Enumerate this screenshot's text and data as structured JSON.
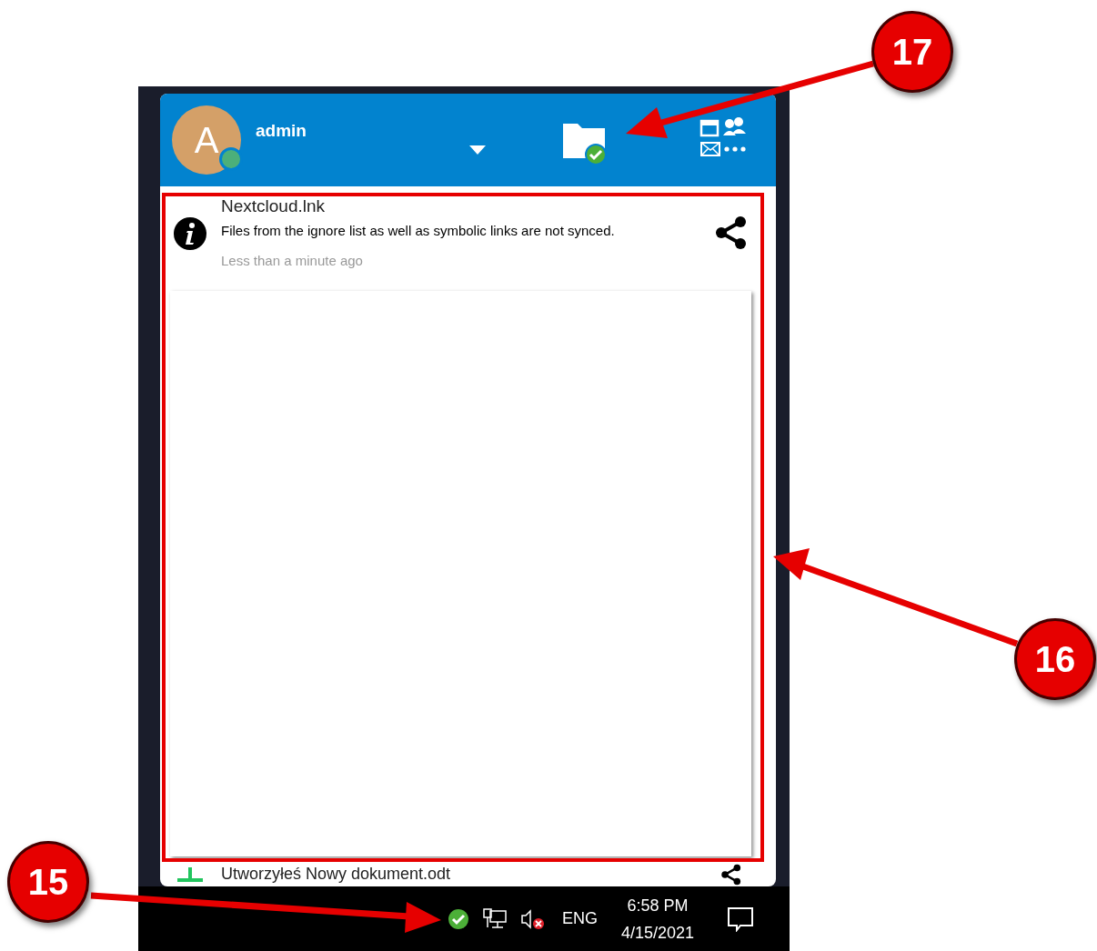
{
  "header": {
    "avatar_letter": "A",
    "user": "admin",
    "online": true
  },
  "activities": [
    {
      "kind": "info",
      "title": "Nextcloud.lnk",
      "message": "Files from the ignore list as well as symbolic links are not synced.",
      "time": "Less than a minute ago"
    },
    {
      "kind": "created",
      "title": "Utworzyłeś Nowy dokument.odt"
    }
  ],
  "taskbar": {
    "language": "ENG",
    "time": "6:58 PM",
    "date": "4/15/2021"
  },
  "callouts": [
    {
      "label": "17"
    },
    {
      "label": "16"
    },
    {
      "label": "15"
    }
  ]
}
